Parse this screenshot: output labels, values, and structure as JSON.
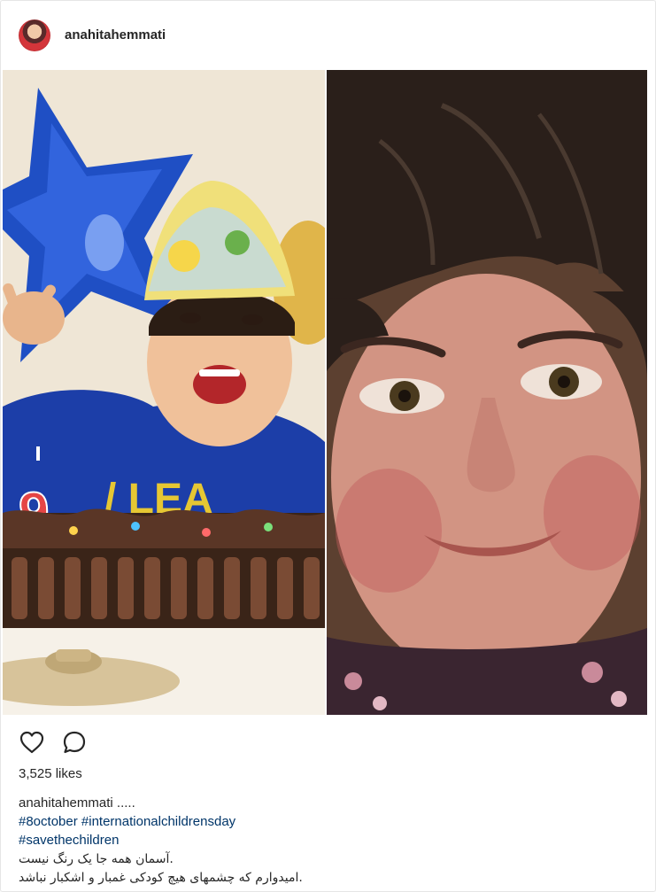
{
  "post": {
    "username": "anahitahemmati",
    "likes_label": "3,525 likes",
    "caption": {
      "username": "anahitahemmati",
      "text": ".....",
      "hashtags_line1": [
        "#8october",
        "#internationalchildrensday"
      ],
      "hashtags_line2": [
        "#savethechildren"
      ],
      "persian_line1": ".آسمان همه جا یک رنگ نیست",
      "persian_line2": ".امیدوارم که چشمهای هیچ کودکی غمبار و اشکبار نباشد"
    },
    "media": {
      "left_photo": "boy-birthday-photo",
      "right_photo": "girl-portrait-photo",
      "candle_number": "9"
    }
  },
  "icons": {
    "like": "heart-icon",
    "comment": "comment-icon"
  },
  "colors": {
    "hashtag": "#003569",
    "text": "#262626",
    "border": "#e6e6e6"
  }
}
